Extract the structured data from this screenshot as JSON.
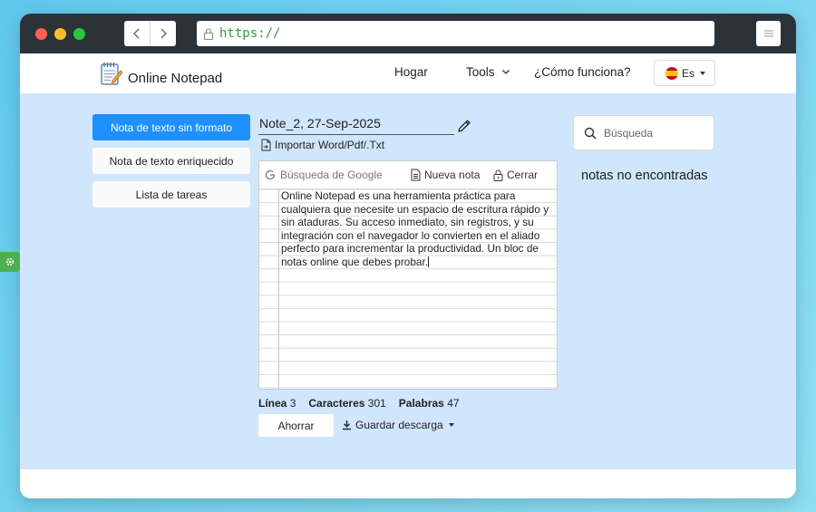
{
  "browser": {
    "url": "https://",
    "colors": {
      "titlebar": "#2c3338",
      "url_text": "#2e9d3c"
    }
  },
  "header": {
    "logo_text": "Online Notepad",
    "nav": [
      {
        "label": "Hogar"
      },
      {
        "label": "Tools"
      },
      {
        "label": "¿Cómo funciona?"
      }
    ],
    "language": "Es"
  },
  "sidebar": {
    "items": [
      {
        "label": "Nota de texto sin formato",
        "active": true
      },
      {
        "label": "Nota de texto enriquecido",
        "active": false
      },
      {
        "label": "Lista de tareas",
        "active": false
      }
    ],
    "colors": {
      "active": "#1e90ff"
    }
  },
  "note": {
    "name": "Note_2, 27-Sep-2025",
    "import_label": "Importar Word/Pdf/.Txt",
    "toolbar": {
      "google_search": "Búsqueda de Google",
      "new_note": "Nueva nota",
      "close": "Cerrar"
    },
    "text": "Online Notepad es una herramienta práctica para\ncualquiera que necesite un espacio de escritura rápido y\nsin ataduras. Su acceso inmediato, sin registros, y su\nintegración con el navegador lo convierten en el aliado\nperfecto para incrementar la productividad. Un bloc de\nnotas online que debes probar."
  },
  "stats": {
    "line_label": "Línea",
    "line_value": "3",
    "chars_label": "Caracteres",
    "chars_value": "301",
    "words_label": "Palabras",
    "words_value": "47"
  },
  "actions": {
    "save_label": "Ahorrar",
    "download_label": "Guardar descarga"
  },
  "search": {
    "placeholder": "Búsqueda",
    "empty_message": "notas no encontradas"
  },
  "icons": [
    "chevron-left-icon",
    "chevron-right-icon",
    "lock-icon",
    "menu-icon",
    "notepad-logo-icon",
    "chevron-down-icon",
    "spain-flag-icon",
    "pencil-icon",
    "file-import-icon",
    "google-g-icon",
    "new-note-icon",
    "padlock-icon",
    "download-icon",
    "search-icon",
    "gear-icon"
  ]
}
